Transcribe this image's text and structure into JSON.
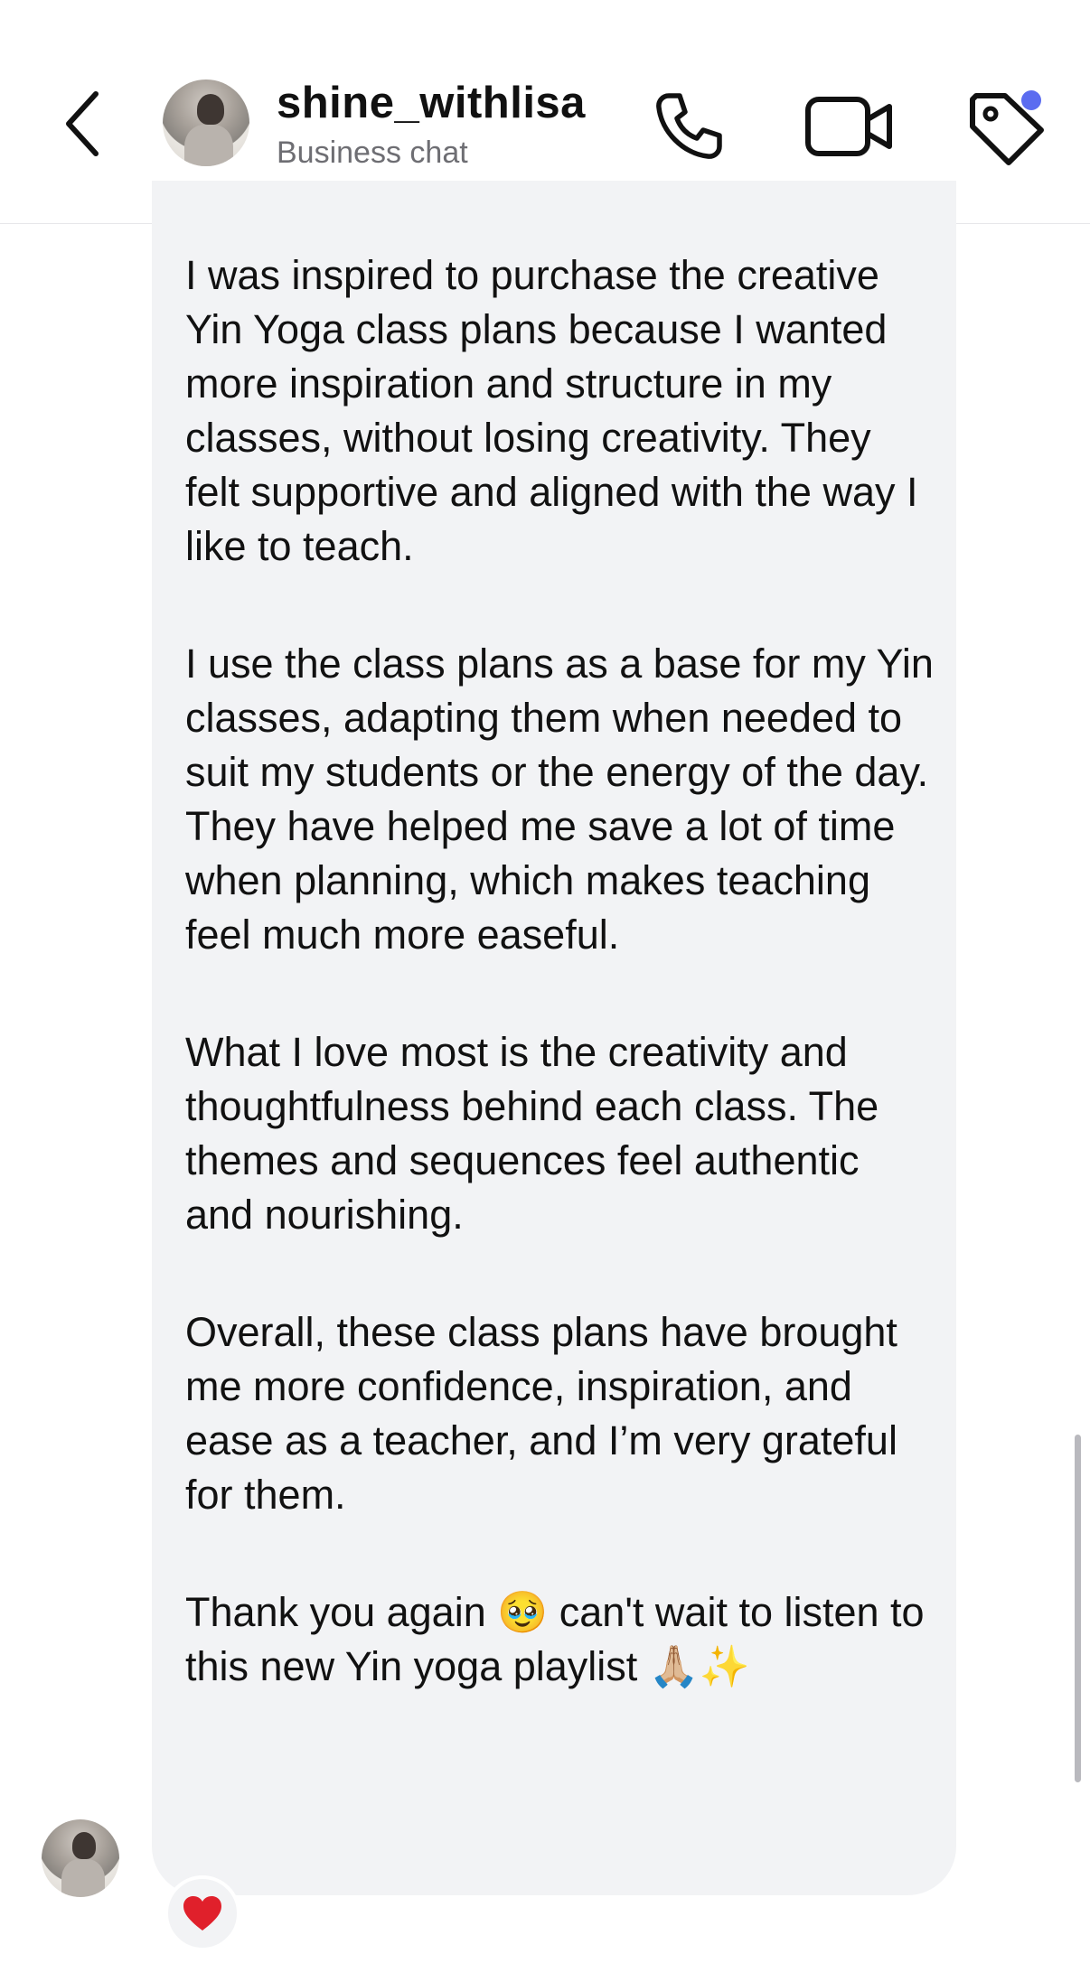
{
  "header": {
    "username": "shine_withlisa",
    "subtitle": "Business chat",
    "icons": [
      "chevron-left-icon",
      "avatar",
      "phone-icon",
      "video-camera-icon",
      "tag-icon"
    ],
    "badge_color": "#5b6cf0"
  },
  "message": {
    "paragraphs": [
      "I was inspired to purchase the creative Yin Yoga class plans because I wanted more inspiration and structure in my classes, without losing creativity. They felt supportive and aligned with the way I like to teach.",
      "I use the class plans as a base for my Yin classes, adapting them when needed to suit my students or the energy of the day. They have helped me save a lot of time when planning, which makes teaching feel much more easeful.",
      "What I love most is the creativity and thoughtfulness behind each class. The themes and sequences feel authentic and nourishing.",
      "Overall, these class plans have brought me more confidence, inspiration, and ease as a teacher, and I’m very grateful for them.",
      "Thank you again 🥹 can't wait to listen to this new Yin yoga playlist 🙏🏼✨"
    ],
    "bubble_color": "#f2f3f5",
    "reaction": "❤️"
  }
}
